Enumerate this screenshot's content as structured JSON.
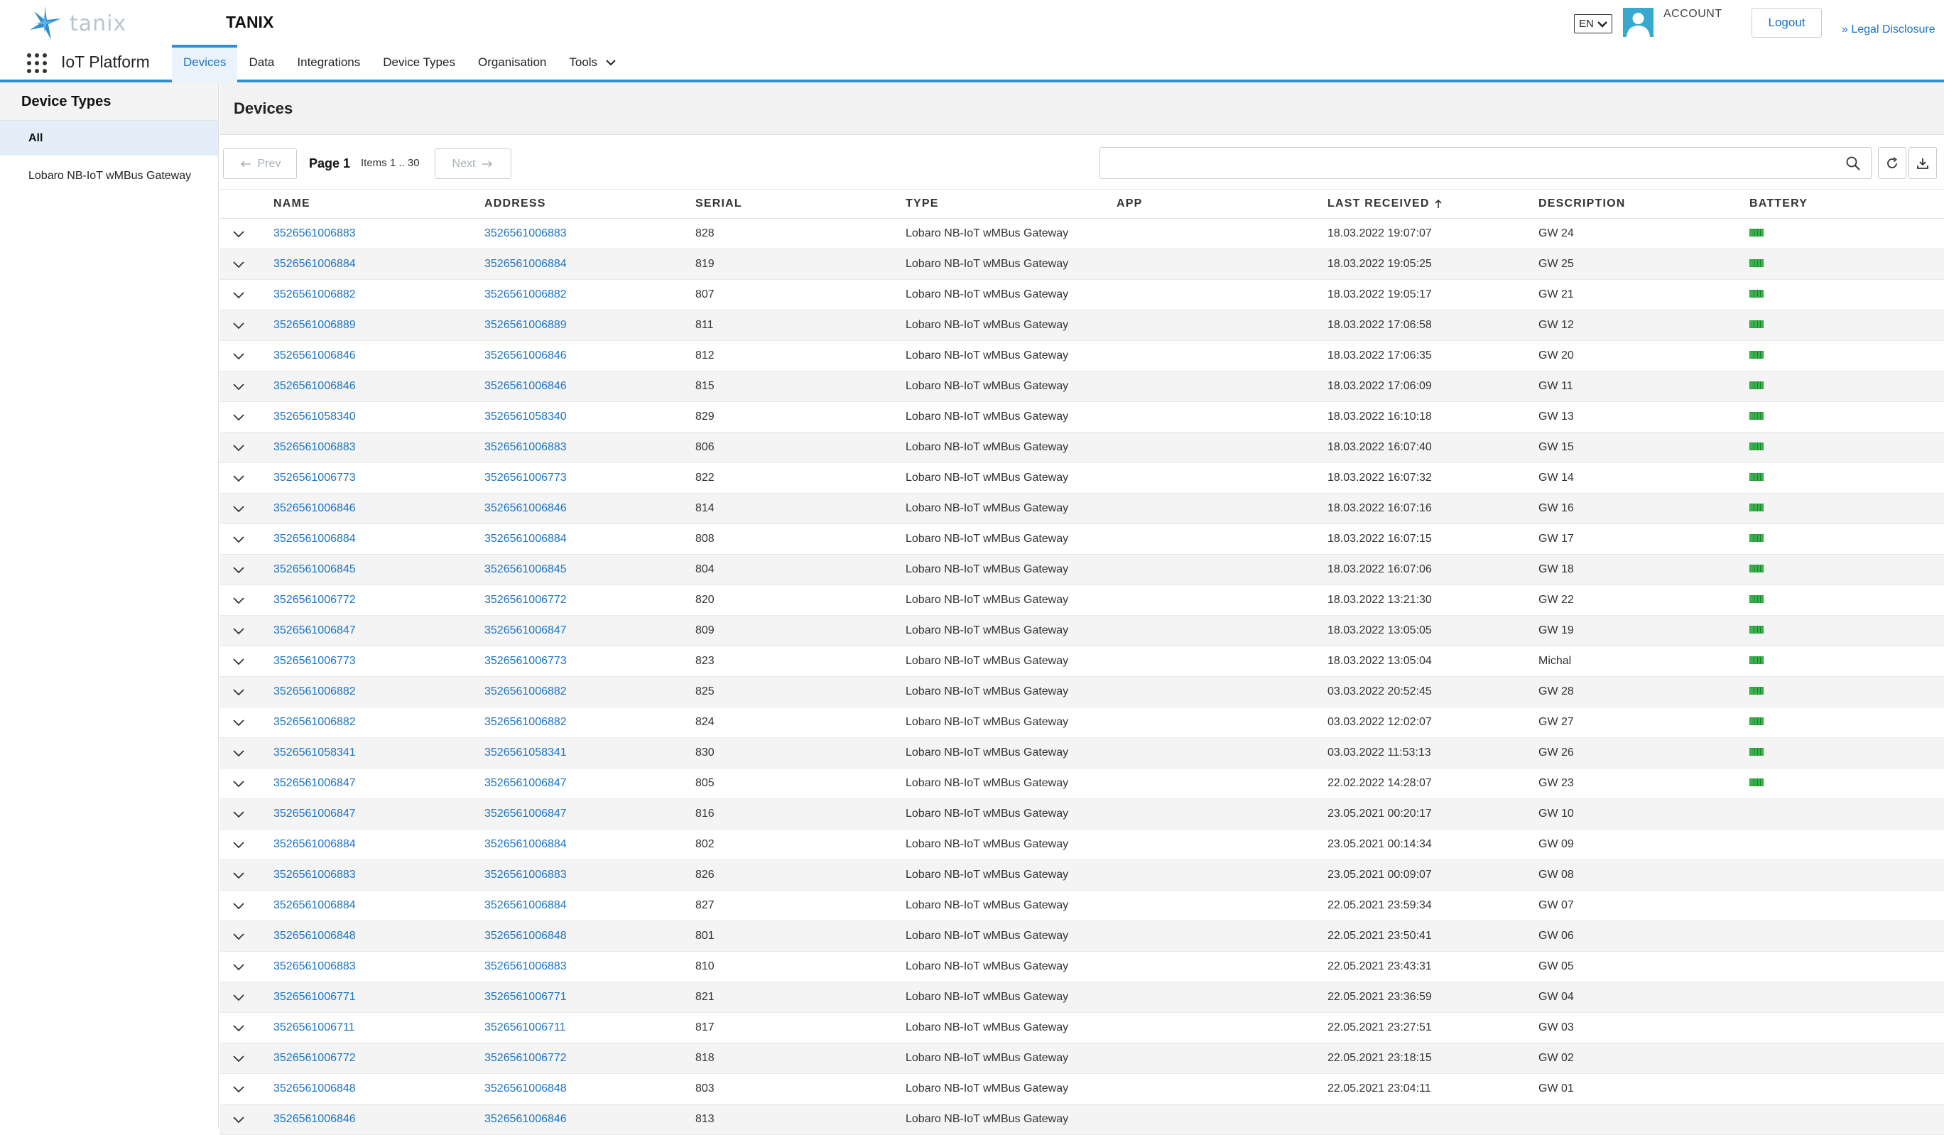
{
  "brand": {
    "logo_text": "tanix",
    "app_title": "TANIX",
    "platform": "IoT Platform"
  },
  "header": {
    "language": "EN",
    "account_label": "ACCOUNT",
    "logout_label": "Logout",
    "legal_label": "» Legal Disclosure"
  },
  "nav": {
    "items": [
      {
        "label": "Devices",
        "active": true
      },
      {
        "label": "Data",
        "active": false
      },
      {
        "label": "Integrations",
        "active": false
      },
      {
        "label": "Device Types",
        "active": false
      },
      {
        "label": "Organisation",
        "active": false
      },
      {
        "label": "Tools",
        "active": false,
        "dropdown": true
      }
    ]
  },
  "sidebar": {
    "title": "Device Types",
    "items": [
      {
        "label": "All",
        "active": true
      },
      {
        "label": "Lobaro NB-IoT wMBus Gateway",
        "active": false
      }
    ]
  },
  "main": {
    "title": "Devices",
    "pagination": {
      "prev_label": "Prev",
      "page_label": "Page 1",
      "items_label": "Items 1 .. 30",
      "next_label": "Next"
    },
    "search": {
      "placeholder": "",
      "value": ""
    },
    "columns": [
      "NAME",
      "ADDRESS",
      "SERIAL",
      "TYPE",
      "APP",
      "LAST RECEIVED",
      "DESCRIPTION",
      "BATTERY"
    ],
    "sort": {
      "column": "LAST RECEIVED",
      "direction": "up"
    },
    "rows": [
      {
        "name": "3526561006883",
        "address": "3526561006883",
        "serial": "828",
        "type": "Lobaro NB-IoT wMBus Gateway",
        "app": "",
        "last_received": "18.03.2022 19:07:07",
        "description": "GW 24",
        "battery": true
      },
      {
        "name": "3526561006884",
        "address": "3526561006884",
        "serial": "819",
        "type": "Lobaro NB-IoT wMBus Gateway",
        "app": "",
        "last_received": "18.03.2022 19:05:25",
        "description": "GW 25",
        "battery": true
      },
      {
        "name": "3526561006882",
        "address": "3526561006882",
        "serial": "807",
        "type": "Lobaro NB-IoT wMBus Gateway",
        "app": "",
        "last_received": "18.03.2022 19:05:17",
        "description": "GW 21",
        "battery": true
      },
      {
        "name": "3526561006889",
        "address": "3526561006889",
        "serial": "811",
        "type": "Lobaro NB-IoT wMBus Gateway",
        "app": "",
        "last_received": "18.03.2022 17:06:58",
        "description": "GW 12",
        "battery": true
      },
      {
        "name": "3526561006846",
        "address": "3526561006846",
        "serial": "812",
        "type": "Lobaro NB-IoT wMBus Gateway",
        "app": "",
        "last_received": "18.03.2022 17:06:35",
        "description": "GW 20",
        "battery": true
      },
      {
        "name": "3526561006846",
        "address": "3526561006846",
        "serial": "815",
        "type": "Lobaro NB-IoT wMBus Gateway",
        "app": "",
        "last_received": "18.03.2022 17:06:09",
        "description": "GW 11",
        "battery": true
      },
      {
        "name": "3526561058340",
        "address": "3526561058340",
        "serial": "829",
        "type": "Lobaro NB-IoT wMBus Gateway",
        "app": "",
        "last_received": "18.03.2022 16:10:18",
        "description": "GW 13",
        "battery": true
      },
      {
        "name": "3526561006883",
        "address": "3526561006883",
        "serial": "806",
        "type": "Lobaro NB-IoT wMBus Gateway",
        "app": "",
        "last_received": "18.03.2022 16:07:40",
        "description": "GW 15",
        "battery": true
      },
      {
        "name": "3526561006773",
        "address": "3526561006773",
        "serial": "822",
        "type": "Lobaro NB-IoT wMBus Gateway",
        "app": "",
        "last_received": "18.03.2022 16:07:32",
        "description": "GW 14",
        "battery": true
      },
      {
        "name": "3526561006846",
        "address": "3526561006846",
        "serial": "814",
        "type": "Lobaro NB-IoT wMBus Gateway",
        "app": "",
        "last_received": "18.03.2022 16:07:16",
        "description": "GW 16",
        "battery": true
      },
      {
        "name": "3526561006884",
        "address": "3526561006884",
        "serial": "808",
        "type": "Lobaro NB-IoT wMBus Gateway",
        "app": "",
        "last_received": "18.03.2022 16:07:15",
        "description": "GW 17",
        "battery": true
      },
      {
        "name": "3526561006845",
        "address": "3526561006845",
        "serial": "804",
        "type": "Lobaro NB-IoT wMBus Gateway",
        "app": "",
        "last_received": "18.03.2022 16:07:06",
        "description": "GW 18",
        "battery": true
      },
      {
        "name": "3526561006772",
        "address": "3526561006772",
        "serial": "820",
        "type": "Lobaro NB-IoT wMBus Gateway",
        "app": "",
        "last_received": "18.03.2022 13:21:30",
        "description": "GW 22",
        "battery": true
      },
      {
        "name": "3526561006847",
        "address": "3526561006847",
        "serial": "809",
        "type": "Lobaro NB-IoT wMBus Gateway",
        "app": "",
        "last_received": "18.03.2022 13:05:05",
        "description": "GW 19",
        "battery": true
      },
      {
        "name": "3526561006773",
        "address": "3526561006773",
        "serial": "823",
        "type": "Lobaro NB-IoT wMBus Gateway",
        "app": "",
        "last_received": "18.03.2022 13:05:04",
        "description": "Michal",
        "battery": true
      },
      {
        "name": "3526561006882",
        "address": "3526561006882",
        "serial": "825",
        "type": "Lobaro NB-IoT wMBus Gateway",
        "app": "",
        "last_received": "03.03.2022 20:52:45",
        "description": "GW 28",
        "battery": true
      },
      {
        "name": "3526561006882",
        "address": "3526561006882",
        "serial": "824",
        "type": "Lobaro NB-IoT wMBus Gateway",
        "app": "",
        "last_received": "03.03.2022 12:02:07",
        "description": "GW 27",
        "battery": true
      },
      {
        "name": "3526561058341",
        "address": "3526561058341",
        "serial": "830",
        "type": "Lobaro NB-IoT wMBus Gateway",
        "app": "",
        "last_received": "03.03.2022 11:53:13",
        "description": "GW 26",
        "battery": true
      },
      {
        "name": "3526561006847",
        "address": "3526561006847",
        "serial": "805",
        "type": "Lobaro NB-IoT wMBus Gateway",
        "app": "",
        "last_received": "22.02.2022 14:28:07",
        "description": "GW 23",
        "battery": true
      },
      {
        "name": "3526561006847",
        "address": "3526561006847",
        "serial": "816",
        "type": "Lobaro NB-IoT wMBus Gateway",
        "app": "",
        "last_received": "23.05.2021 00:20:17",
        "description": "GW 10",
        "battery": false
      },
      {
        "name": "3526561006884",
        "address": "3526561006884",
        "serial": "802",
        "type": "Lobaro NB-IoT wMBus Gateway",
        "app": "",
        "last_received": "23.05.2021 00:14:34",
        "description": "GW 09",
        "battery": false
      },
      {
        "name": "3526561006883",
        "address": "3526561006883",
        "serial": "826",
        "type": "Lobaro NB-IoT wMBus Gateway",
        "app": "",
        "last_received": "23.05.2021 00:09:07",
        "description": "GW 08",
        "battery": false
      },
      {
        "name": "3526561006884",
        "address": "3526561006884",
        "serial": "827",
        "type": "Lobaro NB-IoT wMBus Gateway",
        "app": "",
        "last_received": "22.05.2021 23:59:34",
        "description": "GW 07",
        "battery": false
      },
      {
        "name": "3526561006848",
        "address": "3526561006848",
        "serial": "801",
        "type": "Lobaro NB-IoT wMBus Gateway",
        "app": "",
        "last_received": "22.05.2021 23:50:41",
        "description": "GW 06",
        "battery": false
      },
      {
        "name": "3526561006883",
        "address": "3526561006883",
        "serial": "810",
        "type": "Lobaro NB-IoT wMBus Gateway",
        "app": "",
        "last_received": "22.05.2021 23:43:31",
        "description": "GW 05",
        "battery": false
      },
      {
        "name": "3526561006771",
        "address": "3526561006771",
        "serial": "821",
        "type": "Lobaro NB-IoT wMBus Gateway",
        "app": "",
        "last_received": "22.05.2021 23:36:59",
        "description": "GW 04",
        "battery": false
      },
      {
        "name": "3526561006711",
        "address": "3526561006711",
        "serial": "817",
        "type": "Lobaro NB-IoT wMBus Gateway",
        "app": "",
        "last_received": "22.05.2021 23:27:51",
        "description": "GW 03",
        "battery": false
      },
      {
        "name": "3526561006772",
        "address": "3526561006772",
        "serial": "818",
        "type": "Lobaro NB-IoT wMBus Gateway",
        "app": "",
        "last_received": "22.05.2021 23:18:15",
        "description": "GW 02",
        "battery": false
      },
      {
        "name": "3526561006848",
        "address": "3526561006848",
        "serial": "803",
        "type": "Lobaro NB-IoT wMBus Gateway",
        "app": "",
        "last_received": "22.05.2021 23:04:11",
        "description": "GW 01",
        "battery": false
      },
      {
        "name": "3526561006846",
        "address": "3526561006846",
        "serial": "813",
        "type": "Lobaro NB-IoT wMBus Gateway",
        "app": "",
        "last_received": "",
        "description": "",
        "battery": false
      }
    ]
  },
  "colors": {
    "accent": "#2f8fd0",
    "link": "#1b73c2",
    "battery": "#37b24d",
    "avatar": "#37a9cf"
  }
}
